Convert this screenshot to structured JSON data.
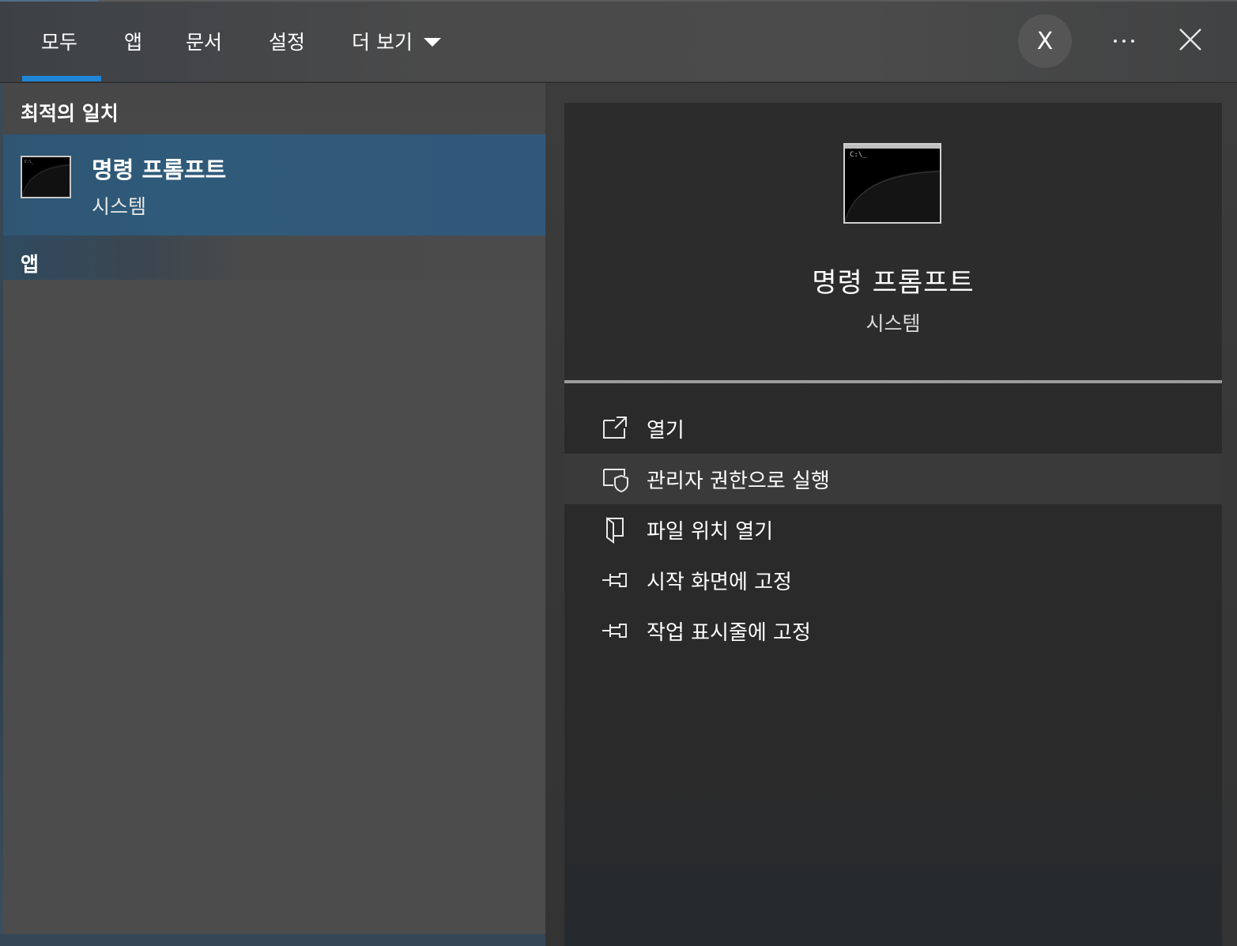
{
  "tabs": [
    {
      "label": "모두",
      "active": true
    },
    {
      "label": "앱"
    },
    {
      "label": "문서"
    },
    {
      "label": "설정"
    },
    {
      "label": "더 보기"
    }
  ],
  "header": {
    "avatar_letter": "X",
    "more_icon": "ellipsis-icon",
    "close_icon": "close-icon"
  },
  "best_match": {
    "section_label": "최적의 일치",
    "title": "명령 프롬프트",
    "subtitle": "시스템",
    "icon": "command-prompt-icon"
  },
  "apps_section": {
    "label": "앱"
  },
  "detail": {
    "title": "명령 프롬프트",
    "subtitle": "시스템",
    "icon_prompt_text": "C:\\_",
    "actions": [
      {
        "label": "열기",
        "icon": "open-icon"
      },
      {
        "label": "관리자 권한으로 실행",
        "icon": "shield-admin-icon"
      },
      {
        "label": "파일 위치 열기",
        "icon": "file-location-icon"
      },
      {
        "label": "시작 화면에 고정",
        "icon": "pin-icon"
      },
      {
        "label": "작업 표시줄에 고정",
        "icon": "pin-icon"
      }
    ]
  },
  "colors": {
    "accent": "#1f86d8",
    "selected_row": "#2f5572",
    "hover_row": "#3a3a3a"
  }
}
